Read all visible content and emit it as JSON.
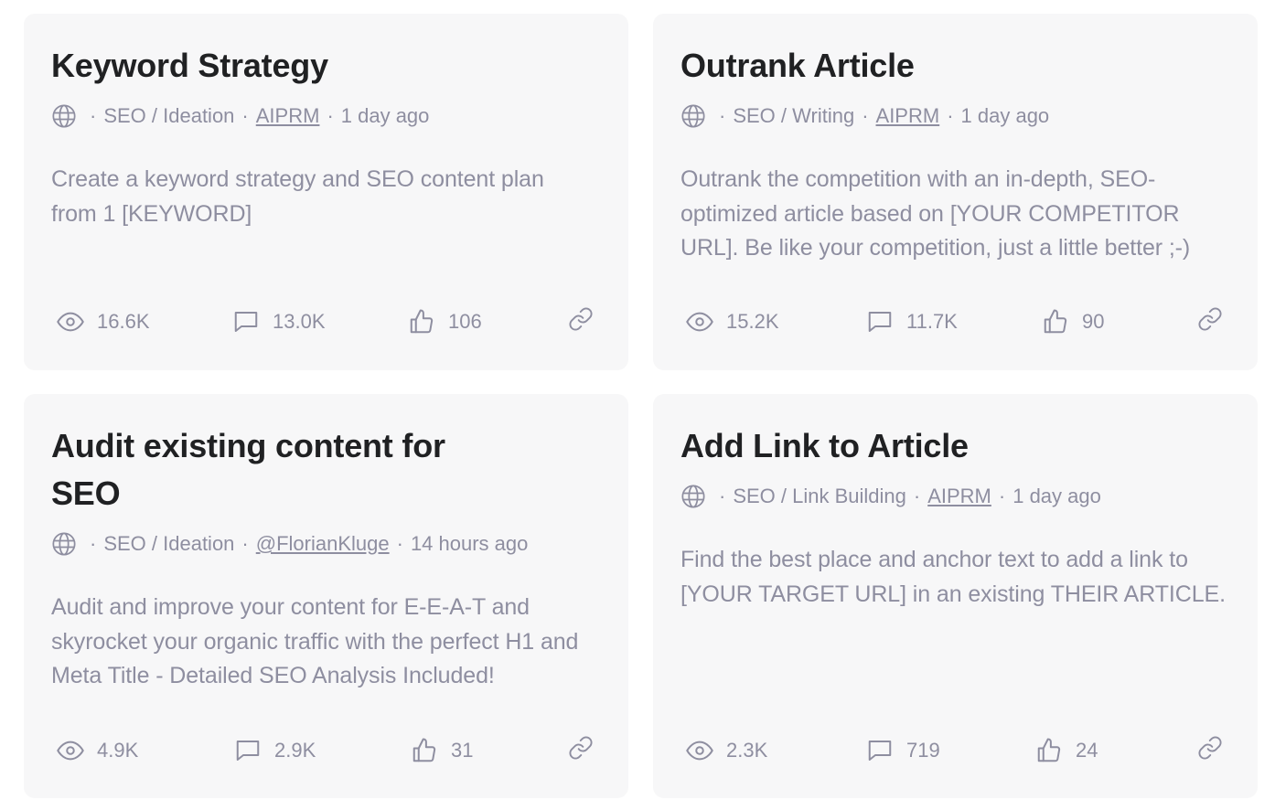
{
  "prompts": [
    {
      "title": "Keyword Strategy",
      "category": "SEO / Ideation",
      "author": "AIPRM",
      "time": "1 day ago",
      "description": "Create a keyword strategy and SEO content plan from 1 [KEYWORD]",
      "views": "16.6K",
      "comments": "13.0K",
      "likes": "106"
    },
    {
      "title": "Outrank Article",
      "category": "SEO / Writing",
      "author": "AIPRM",
      "time": "1 day ago",
      "description": "Outrank the competition with an in-depth, SEO-optimized article based on [YOUR COMPETITOR URL]. Be like your competition, just a little better ;-)",
      "views": "15.2K",
      "comments": "11.7K",
      "likes": "90"
    },
    {
      "title": "Audit existing content for SEO",
      "category": "SEO / Ideation",
      "author": "@FlorianKluge",
      "time": "14 hours ago",
      "description": "Audit and improve your content for E-E-A-T and skyrocket your organic traffic with the perfect H1 and Meta Title - Detailed SEO Analysis Included!",
      "views": "4.9K",
      "comments": "2.9K",
      "likes": "31"
    },
    {
      "title": "Add Link to Article",
      "category": "SEO / Link Building",
      "author": "AIPRM",
      "time": "1 day ago",
      "description": "Find the best place and anchor text to add a link to [YOUR TARGET URL] in an existing THEIR ARTICLE.",
      "views": "2.3K",
      "comments": "719",
      "likes": "24"
    }
  ],
  "icons": {
    "visibility": "globe-icon",
    "views": "eye-icon",
    "comments": "comment-icon",
    "likes": "thumbs-up-icon",
    "copy_link": "link-icon"
  },
  "colors": {
    "card_bg": "#f7f7f8",
    "title": "#202123",
    "muted": "#8e8ea0"
  },
  "separator": "·"
}
